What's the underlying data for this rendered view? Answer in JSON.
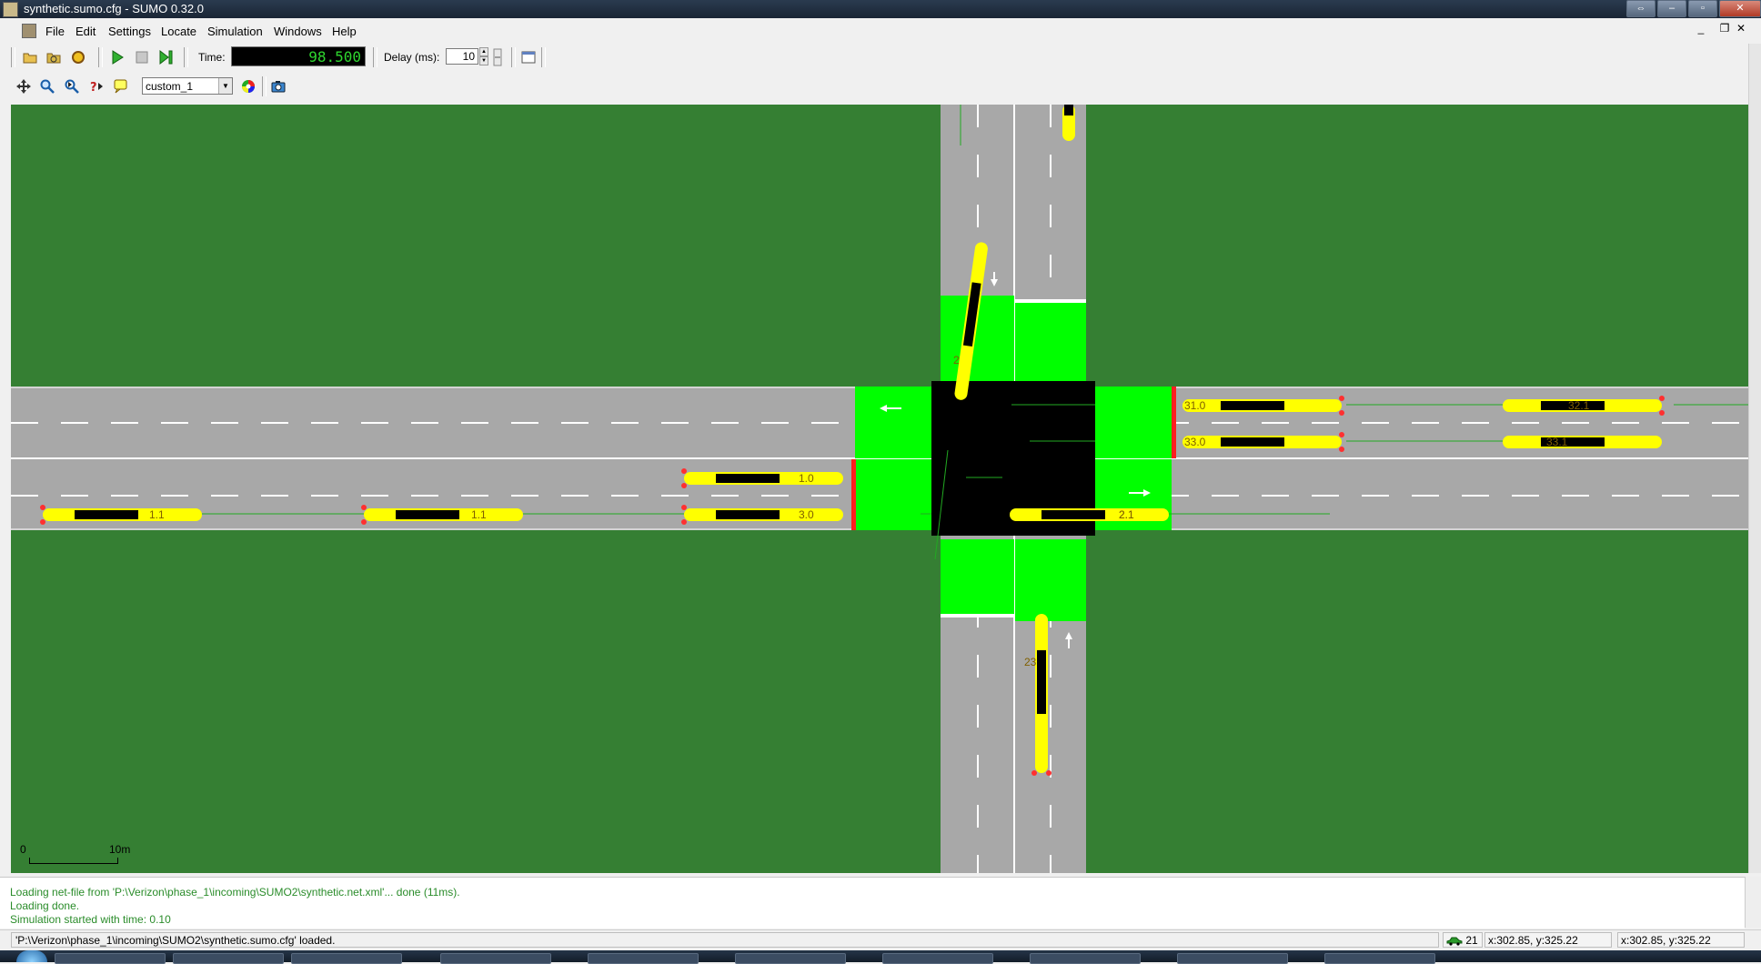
{
  "window": {
    "title": "synthetic.sumo.cfg - SUMO 0.32.0"
  },
  "menu": {
    "items": [
      "File",
      "Edit",
      "Settings",
      "Locate",
      "Simulation",
      "Windows",
      "Help"
    ]
  },
  "toolbar": {
    "time_label": "Time:",
    "time_value": "98.500",
    "delay_label": "Delay (ms):",
    "delay_value": "10"
  },
  "view": {
    "scheme": "custom_1"
  },
  "canvas": {
    "scale": {
      "start": "0",
      "end": "10m"
    },
    "vehicle_labels": [
      "1.1",
      "1.0",
      "1.1",
      "2.1",
      "3.0",
      "31.0",
      "32.1",
      "33.0",
      "33.1",
      "2.1",
      "2",
      "23"
    ]
  },
  "log": {
    "lines": [
      "Loading net-file from 'P:\\Verizon\\phase_1\\incoming\\SUMO2\\synthetic.net.xml'... done (11ms).",
      "Loading done.",
      "Simulation started with time: 0.10"
    ]
  },
  "status": {
    "message": "'P:\\Verizon\\phase_1\\incoming\\SUMO2\\synthetic.sumo.cfg' loaded.",
    "vehicle_count": "21",
    "coords_1": "x:302.85, y:325.22",
    "coords_2": "x:302.85, y:325.22"
  },
  "colors": {
    "grass": "#357f33",
    "road": "#a8a8a8",
    "junction": "#000000",
    "green_light": "#00ff00",
    "vehicle": "#ffff00",
    "time_text": "#2fd72f"
  },
  "icons": [
    "open-icon",
    "reload-icon",
    "recent-icon",
    "run-icon",
    "stop-icon",
    "step-icon",
    "new-view-icon",
    "recenter-icon",
    "zoom-icon",
    "locate-icon",
    "help-icon",
    "tooltip-icon",
    "color-wheel-icon",
    "screenshot-icon"
  ]
}
